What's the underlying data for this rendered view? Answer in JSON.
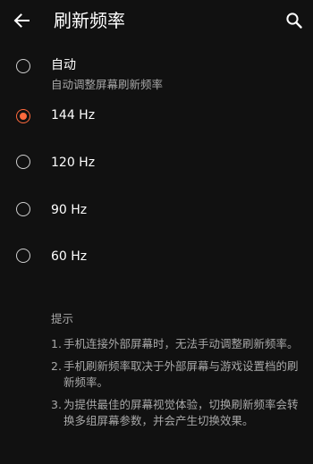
{
  "header": {
    "title": "刷新频率",
    "back_icon": "arrow-left-icon",
    "search_icon": "search-icon"
  },
  "options": [
    {
      "label": "自动",
      "sublabel": "自动调整屏幕刷新频率",
      "selected": false
    },
    {
      "label": "144 Hz",
      "selected": true
    },
    {
      "label": "120 Hz",
      "selected": false
    },
    {
      "label": "90 Hz",
      "selected": false
    },
    {
      "label": "60 Hz",
      "selected": false
    }
  ],
  "tips": {
    "title": "提示",
    "items": [
      {
        "num": "1.",
        "text": "手机连接外部屏幕时，无法手动调整刷新频率。"
      },
      {
        "num": "2.",
        "text": "手机刷新频率取决于外部屏幕与游戏设置档的刷新频率。"
      },
      {
        "num": "3.",
        "text": "为提供最佳的屏幕视觉体验，切换刷新频率会转换多组屏幕参数，并会产生切换效果。"
      }
    ]
  },
  "colors": {
    "background": "#111111",
    "accent": "#ff6a3d",
    "text_primary": "#ffffff",
    "text_secondary": "#a8a8a8"
  }
}
